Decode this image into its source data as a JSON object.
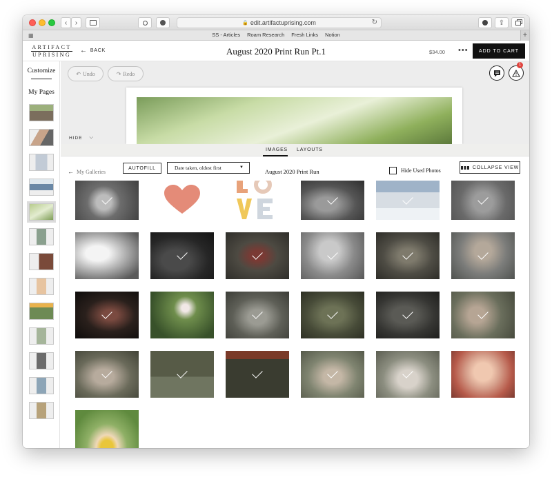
{
  "browser": {
    "url": "edit.artifactuprising.com",
    "favorites": [
      "SS - Articles",
      "Roam Research",
      "Fresh Links",
      "Notion"
    ]
  },
  "header": {
    "logo_line1": "ARTIFACT",
    "logo_line2": "UPRISING",
    "back_label": "BACK",
    "project_title": "August 2020 Print Run Pt.1",
    "price": "$34.00",
    "more_label": "•••",
    "add_to_cart_label": "ADD TO CART"
  },
  "sidebar": {
    "customize_label": "Customize",
    "my_pages_label": "My Pages",
    "selected_index": 4,
    "page_count": 14
  },
  "canvas": {
    "undo_label": "Undo",
    "redo_label": "Redo",
    "alert_count": "1",
    "hide_label": "HIDE"
  },
  "images_panel": {
    "tabs": [
      "IMAGES",
      "LAYOUTS"
    ],
    "active_tab": "IMAGES",
    "back_label": "My Galleries",
    "autofill_label": "AUTOFILL",
    "sort_value": "Date taken, oldest first",
    "gallery_title": "August 2020 Print Run",
    "hide_used_label": "Hide Used Photos",
    "hide_used_checked": false,
    "collapse_label": "COLLAPSE VIEW"
  },
  "colors": {
    "accent_black": "#111111",
    "alert_red": "#e0443e",
    "heart": "#e48b78",
    "love_orange": "#e8a27a",
    "love_yellow": "#f0c85a",
    "love_gray": "#cfd6de"
  }
}
